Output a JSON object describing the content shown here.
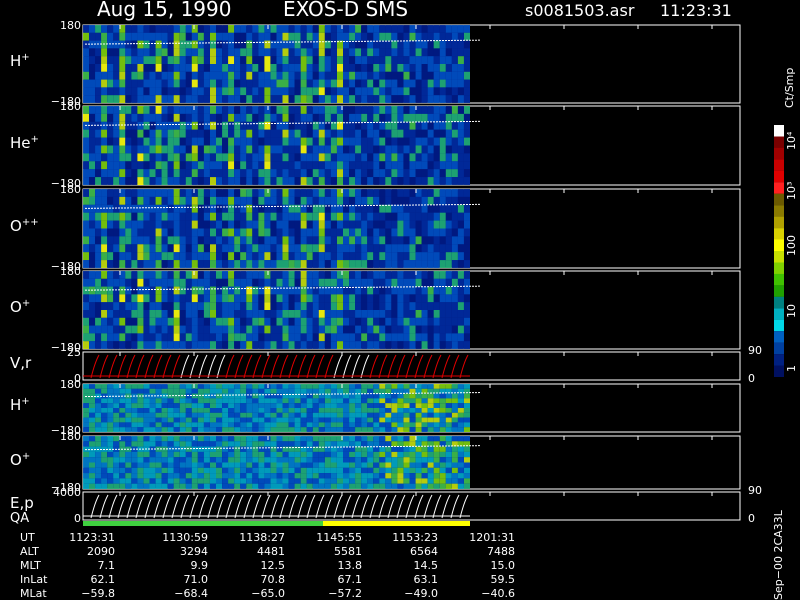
{
  "header": {
    "date": "Aug 15, 1990",
    "instrument": "EXOS-D SMS",
    "file": "s0081503.asr",
    "time": "11:23:31"
  },
  "panels": [
    {
      "label": "H",
      "sup": "+",
      "top_tick": "180",
      "bot_tick": "−180",
      "kind": "spec"
    },
    {
      "label": "He",
      "sup": "+",
      "top_tick": "180",
      "bot_tick": "−180",
      "kind": "spec"
    },
    {
      "label": "O",
      "sup": "++",
      "top_tick": "180",
      "bot_tick": "−180",
      "kind": "spec"
    },
    {
      "label": "O",
      "sup": "+",
      "top_tick": "180",
      "bot_tick": "−180",
      "kind": "spec"
    },
    {
      "label": "V,r",
      "sup": "",
      "top_tick": "25",
      "bot_tick": "0",
      "right_top": "90",
      "right_bot": "0",
      "kind": "line"
    },
    {
      "label": "H",
      "sup": "+",
      "top_tick": "180",
      "bot_tick": "−180",
      "kind": "spec"
    },
    {
      "label": "O",
      "sup": "+",
      "top_tick": "180",
      "bot_tick": "−180",
      "kind": "spec"
    },
    {
      "label": "E,p",
      "sup": "",
      "top_tick": "4000",
      "bot_tick": "0",
      "right_top": "90",
      "right_bot": "0",
      "kind": "line"
    }
  ],
  "qa_label": "QA",
  "colorbar": {
    "unit": "Ct/Smp",
    "labels": [
      "10⁴",
      "10³",
      "100",
      "10",
      "1"
    ],
    "colors": [
      "#ffffff",
      "#7a0000",
      "#a00000",
      "#c80000",
      "#e00000",
      "#ff2020",
      "#6b5a00",
      "#8a7a00",
      "#b0a000",
      "#d8d000",
      "#ffff00",
      "#c8e000",
      "#80d000",
      "#40c000",
      "#20a000",
      "#008080",
      "#00b0c0",
      "#00d8e8",
      "#0060c0",
      "#0040a0",
      "#002080",
      "#001060"
    ]
  },
  "side_note": "Sep−00 2CA33L",
  "footer": {
    "columns": [
      "1123:31",
      "1130:59",
      "1138:27",
      "1145:55",
      "1153:23",
      "1201:31"
    ],
    "rows": [
      {
        "name": "UT",
        "values": [
          "1123:31",
          "1130:59",
          "1138:27",
          "1145:55",
          "1153:23",
          "1201:31"
        ]
      },
      {
        "name": "ALT",
        "values": [
          "2090",
          "3294",
          "4481",
          "5581",
          "6564",
          "7488"
        ]
      },
      {
        "name": "MLT",
        "values": [
          "7.1",
          "9.9",
          "12.5",
          "13.8",
          "14.5",
          "15.0"
        ]
      },
      {
        "name": "InLat",
        "values": [
          "62.1",
          "71.0",
          "70.8",
          "67.1",
          "63.1",
          "59.5"
        ]
      },
      {
        "name": "MLat",
        "values": [
          "−59.8",
          "−68.4",
          "−65.0",
          "−57.2",
          "−49.0",
          "−40.6"
        ]
      }
    ]
  },
  "colors": {
    "background": "#000000",
    "frame": "#ffffff",
    "spec_base": "#001a80",
    "trace": "#ffffff",
    "vr_red": "#e00000",
    "qa_green": "#40d040",
    "qa_yellow": "#ffff00"
  }
}
